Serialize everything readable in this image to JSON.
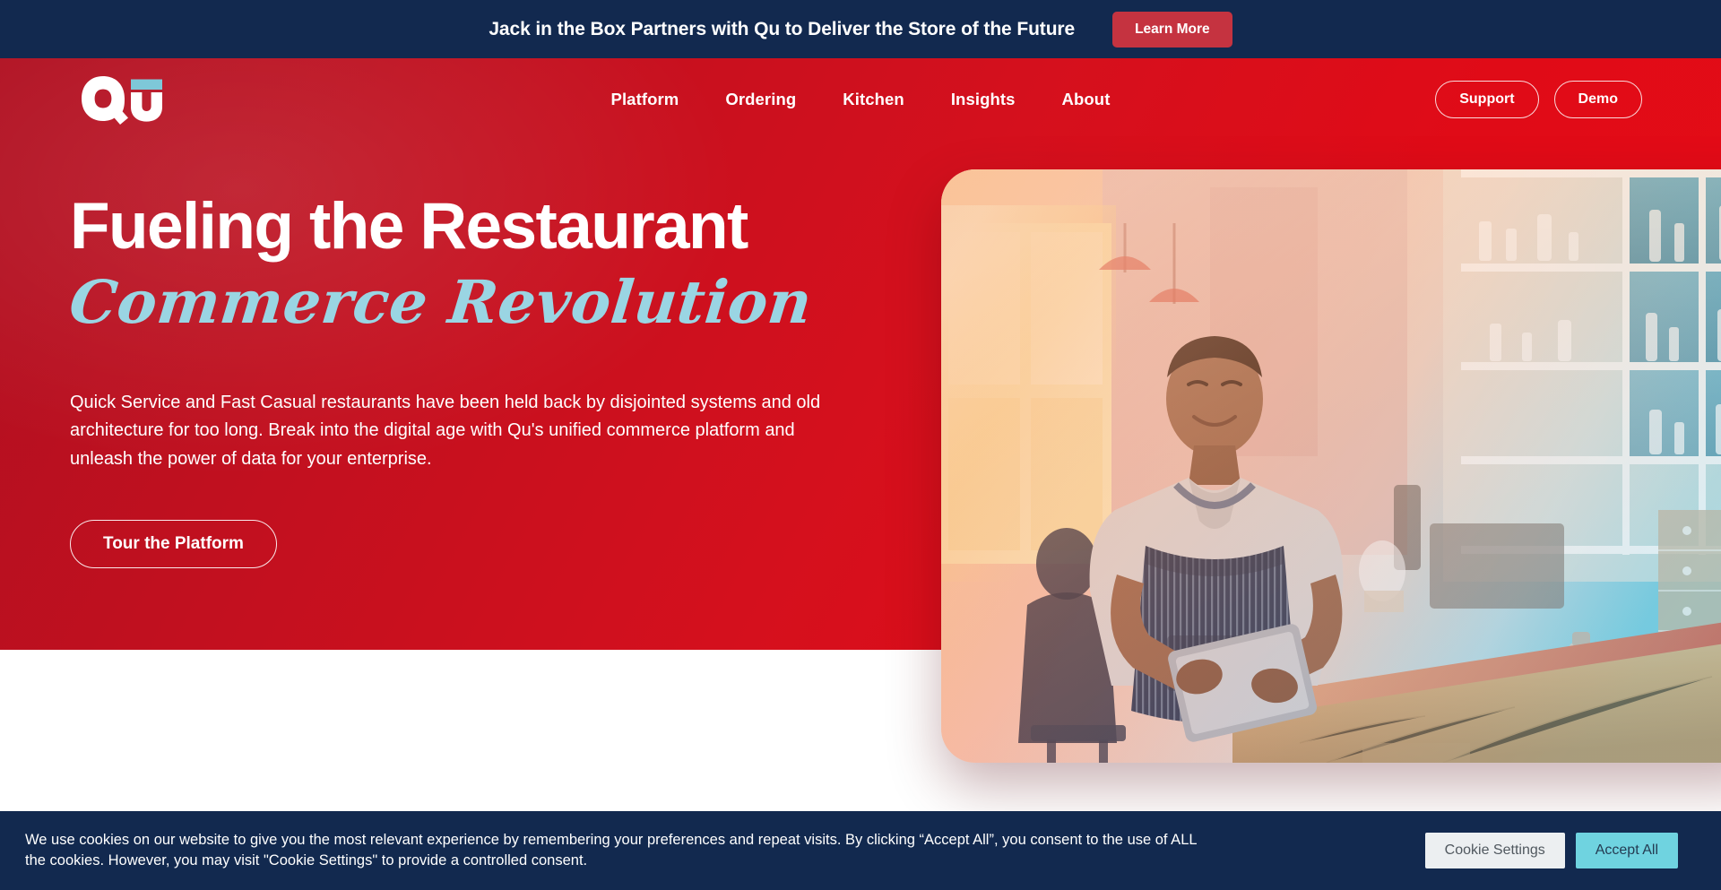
{
  "announcement": {
    "text": "Jack in the Box Partners with Qu to Deliver the Store of the Future",
    "button_label": "Learn More",
    "bg_color": "#12294f",
    "button_color": "#c53340"
  },
  "nav": {
    "logo_text": "Qu",
    "logo_accent_color": "#7ec8d8",
    "links": [
      {
        "label": "Platform"
      },
      {
        "label": "Ordering"
      },
      {
        "label": "Kitchen"
      },
      {
        "label": "Insights"
      },
      {
        "label": "About"
      }
    ],
    "support_label": "Support",
    "demo_label": "Demo",
    "bg_color": "#d5101d"
  },
  "hero": {
    "headline_line1": "Fueling the Restaurant",
    "headline_line2": "Commerce Revolution",
    "headline_accent_color": "#9ad5e3",
    "paragraph": "Quick Service and Fast Casual restaurants have been held back by disjointed systems and old architecture for too long. Break into the digital age with Qu's unified commerce platform and unleash the power of data for your enterprise.",
    "cta_label": "Tour the Platform",
    "image_alt": "Restaurant worker in striped apron using a tablet at a cafe counter"
  },
  "cookie_consent": {
    "text": "We use cookies on our website to give you the most relevant experience by remembering your preferences and repeat visits. By clicking “Accept All”, you consent to the use of ALL the cookies. However, you may visit \"Cookie Settings\" to provide a controlled consent.",
    "settings_label": "Cookie Settings",
    "accept_label": "Accept All",
    "bg_color": "#12294f",
    "accept_color": "#6fd3e0"
  }
}
